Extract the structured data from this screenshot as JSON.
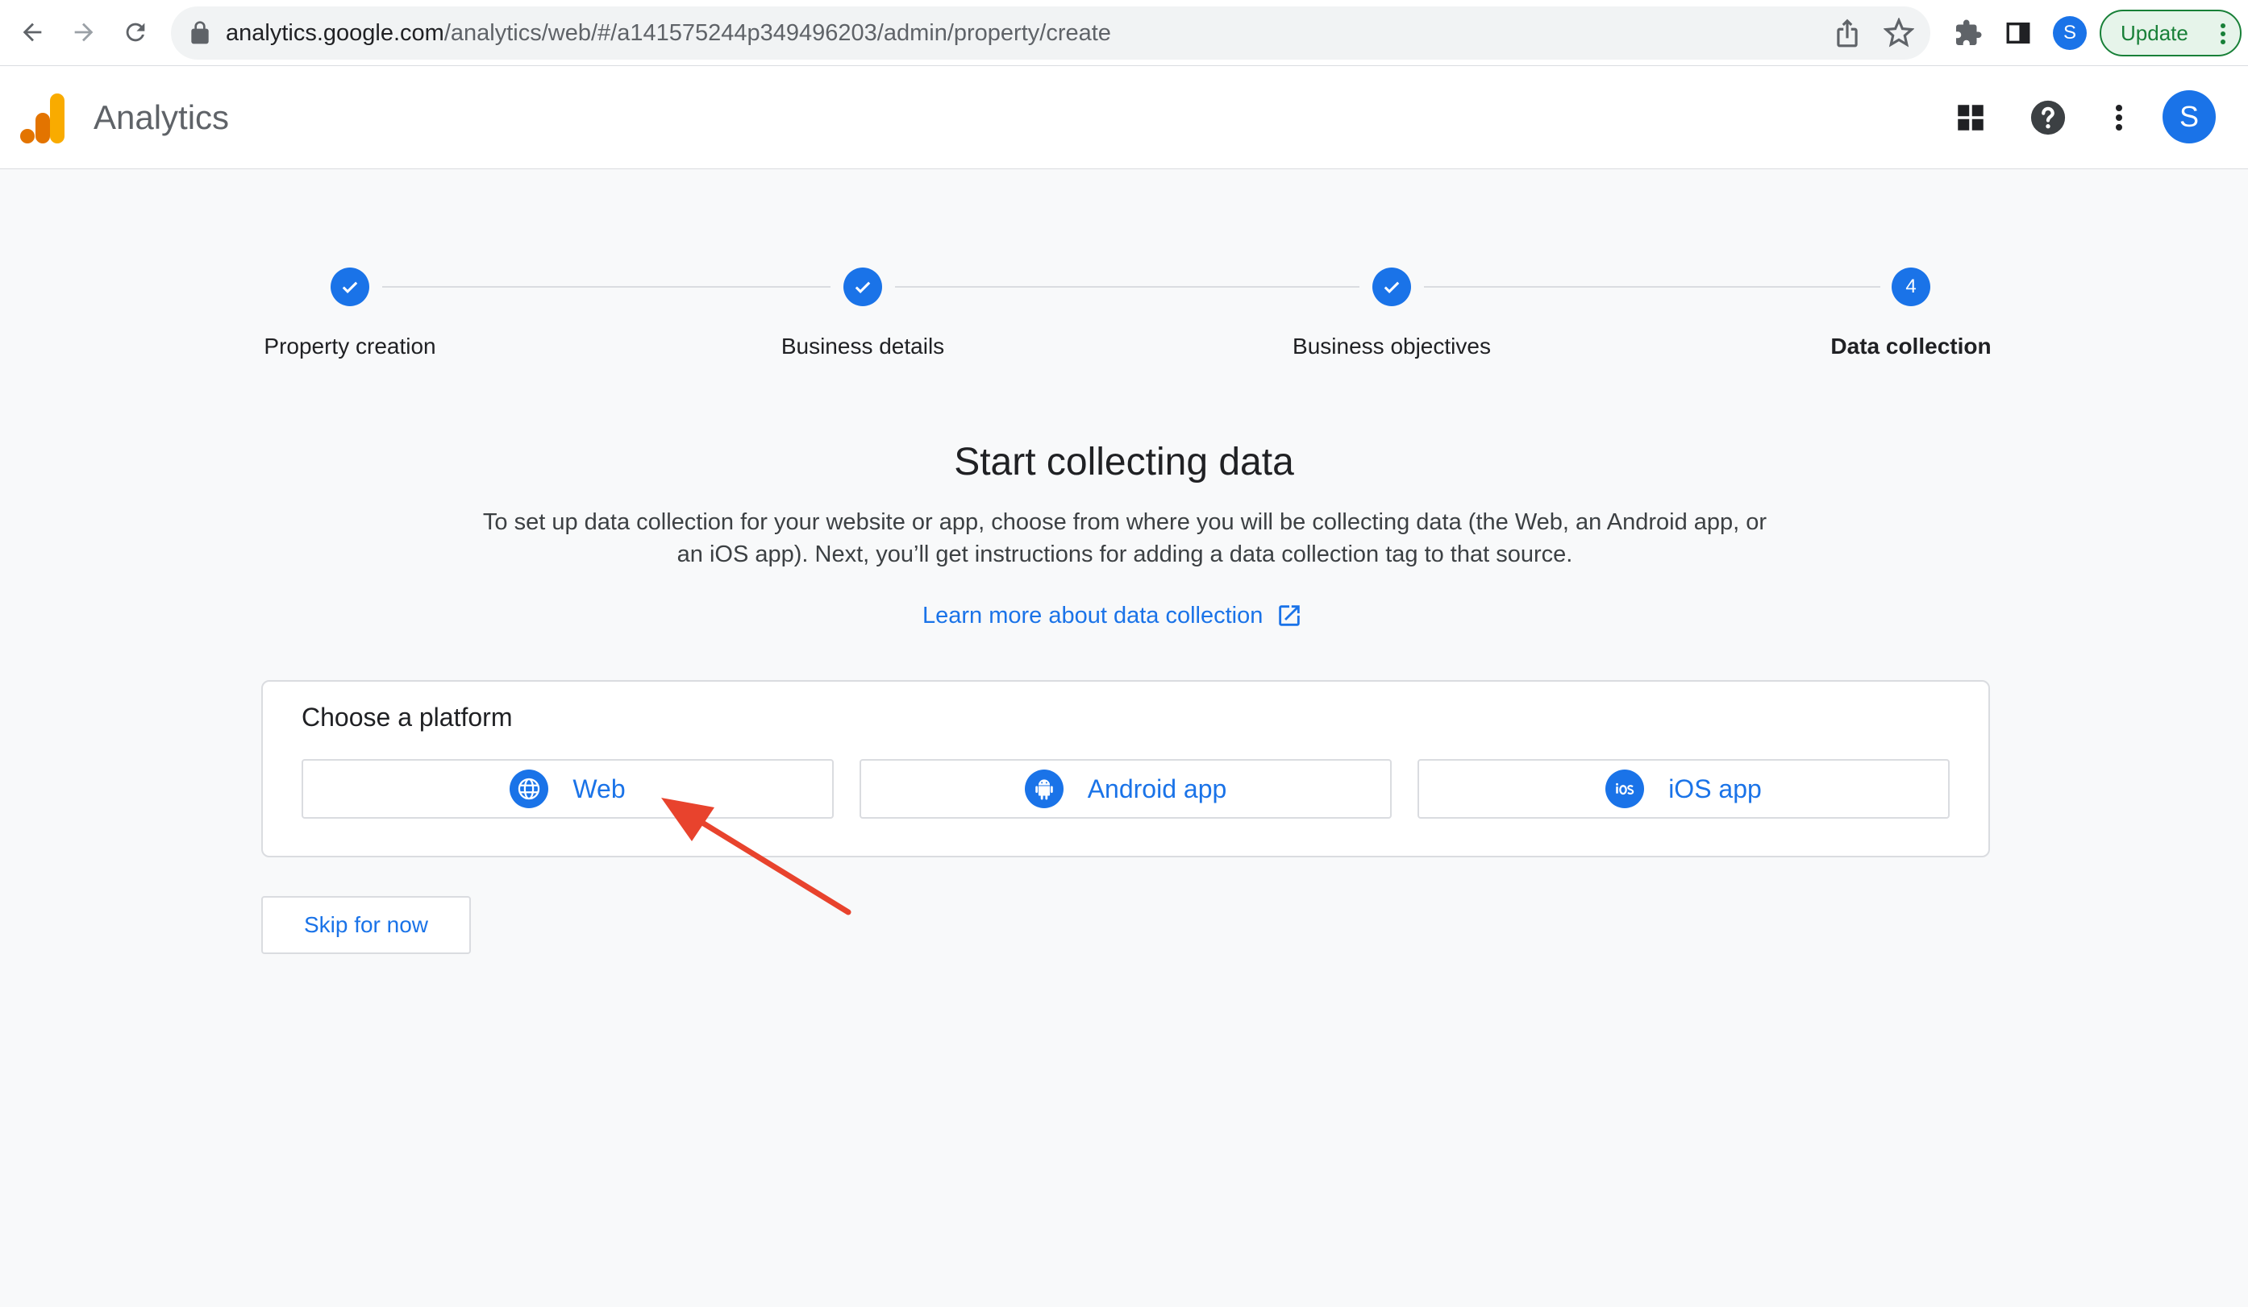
{
  "browser": {
    "url_host": "analytics.google.com",
    "url_path": "/analytics/web/#/a141575244p349496203/admin/property/create",
    "profile_initial": "S",
    "update_label": "Update"
  },
  "app": {
    "title": "Analytics",
    "avatar_initial": "S"
  },
  "stepper": {
    "steps": [
      {
        "label": "Property creation",
        "state": "done"
      },
      {
        "label": "Business details",
        "state": "done"
      },
      {
        "label": "Business objectives",
        "state": "done"
      },
      {
        "label": "Data collection",
        "state": "active",
        "number": "4"
      }
    ]
  },
  "main": {
    "title": "Start collecting data",
    "description": "To set up data collection for your website or app, choose from where you will be collecting data (the Web, an Android app, or an iOS app). Next, you’ll get instructions for adding a data collection tag to that source.",
    "learn_more": "Learn more about data collection"
  },
  "platform": {
    "title": "Choose a platform",
    "options": [
      {
        "label": "Web",
        "icon": "globe-icon"
      },
      {
        "label": "Android app",
        "icon": "android-icon"
      },
      {
        "label": "iOS app",
        "icon": "ios-icon"
      }
    ]
  },
  "skip_label": "Skip for now",
  "colors": {
    "accent": "#1a73e8",
    "annotation_arrow": "#e8432d",
    "logo_orange": "#f9ab00",
    "logo_dark_orange": "#e37400"
  }
}
